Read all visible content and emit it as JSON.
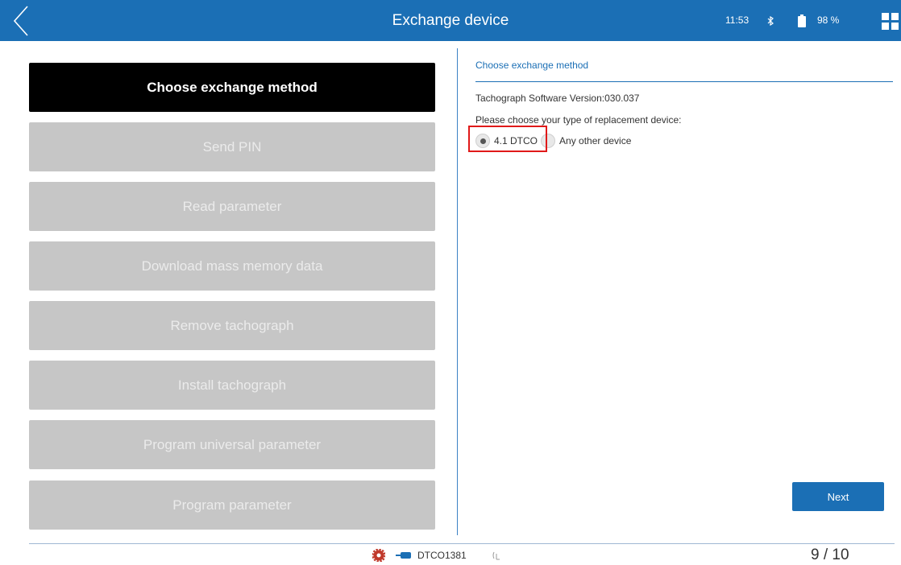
{
  "header": {
    "title": "Exchange device",
    "time": "11:53",
    "battery": "98 %",
    "back_icon": "chevron-left-icon",
    "bluetooth_icon": "bluetooth-icon",
    "battery_icon": "battery-icon",
    "menu_icon": "grid-icon"
  },
  "sidebar": {
    "items": [
      {
        "label": "Choose exchange method",
        "active": true
      },
      {
        "label": "Send PIN",
        "active": false
      },
      {
        "label": "Read parameter",
        "active": false
      },
      {
        "label": "Download mass memory data",
        "active": false
      },
      {
        "label": "Remove tachograph",
        "active": false
      },
      {
        "label": "Install tachograph",
        "active": false
      },
      {
        "label": "Program universal parameter",
        "active": false
      },
      {
        "label": "Program parameter",
        "active": false
      }
    ]
  },
  "panel": {
    "heading": "Choose exchange method",
    "software_version": "Tachograph Software Version:030.037",
    "prompt": "Please choose your type of replacement device:",
    "options": [
      {
        "label": "4.1 DTCO",
        "selected": true
      },
      {
        "label": "Any other device",
        "selected": false
      }
    ],
    "next_label": "Next"
  },
  "footer": {
    "device_label": "DTCO1381",
    "page_indicator": "9 / 10",
    "gear_icon": "gear-icon",
    "usb_icon": "usb-icon",
    "signal_icon": "signal-icon"
  },
  "colors": {
    "accent": "#1b6fb5",
    "active_item": "#000000",
    "inactive_item": "#c6c6c6",
    "highlight": "#e01919"
  }
}
